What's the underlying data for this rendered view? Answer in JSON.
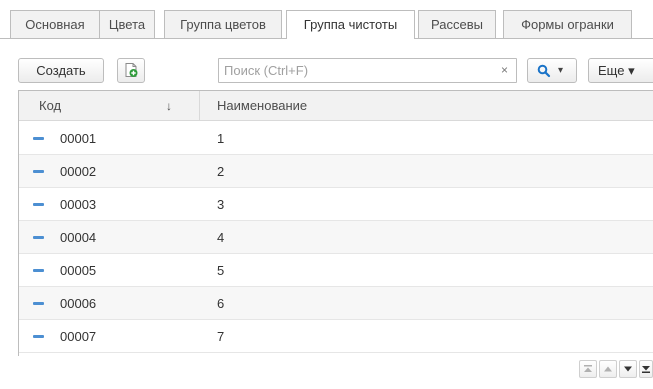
{
  "tabs": [
    {
      "label": "Основная"
    },
    {
      "label": "Цвета"
    },
    {
      "label": "Группа цветов"
    },
    {
      "label": "Группа чистоты",
      "active": true
    },
    {
      "label": "Рассевы"
    },
    {
      "label": "Формы огранки"
    }
  ],
  "toolbar": {
    "create_label": "Создать",
    "search_placeholder": "Поиск (Ctrl+F)",
    "clear_glyph": "×",
    "more_label": "Еще ▾",
    "search_dropdown_glyph": "▾"
  },
  "table": {
    "columns": [
      {
        "label": "Код",
        "sort_glyph": "↓"
      },
      {
        "label": "Наименование"
      }
    ],
    "rows": [
      {
        "code": "00001",
        "name": "1"
      },
      {
        "code": "00002",
        "name": "2"
      },
      {
        "code": "00003",
        "name": "3"
      },
      {
        "code": "00004",
        "name": "4"
      },
      {
        "code": "00005",
        "name": "5"
      },
      {
        "code": "00006",
        "name": "6"
      },
      {
        "code": "00007",
        "name": "7"
      }
    ]
  },
  "nav": {
    "first_glyph": "⏶",
    "prev_glyph": "▲",
    "next_glyph": "▼",
    "last_glyph": "⏷"
  },
  "colors": {
    "accent": "#4c8fd2",
    "search_icon": "#1a73c8",
    "add_icon": "#2e9b3a"
  }
}
